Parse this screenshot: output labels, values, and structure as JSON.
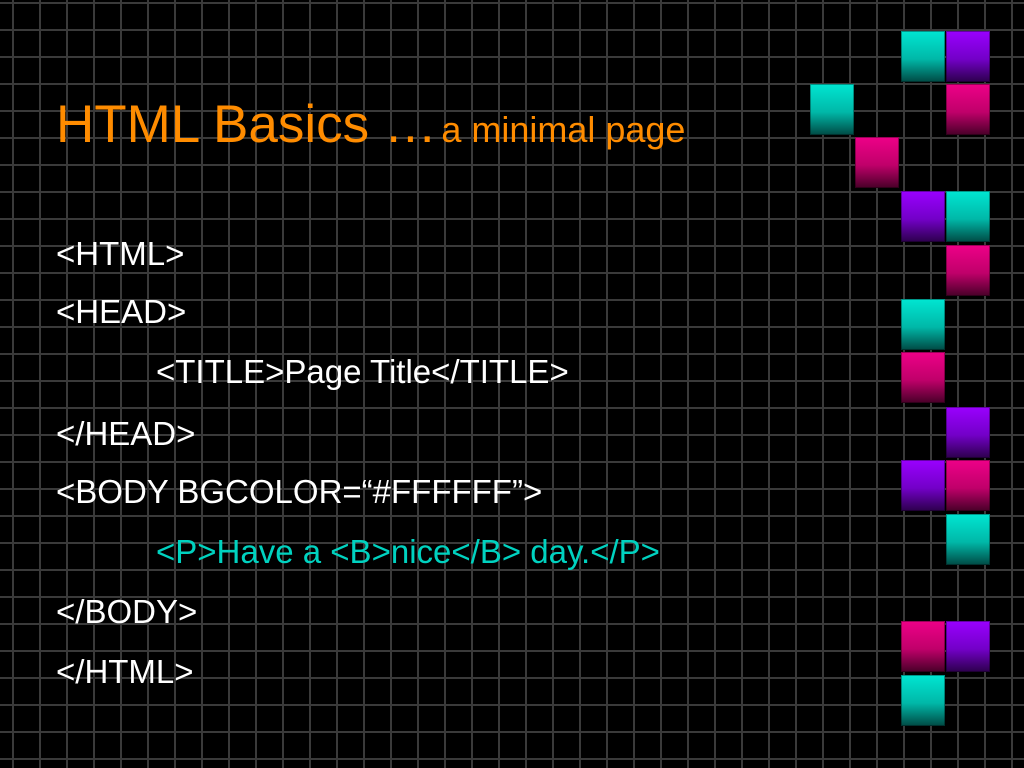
{
  "slide": {
    "title_main": "HTML Basics …",
    "title_sub": "a minimal page",
    "code_lines": [
      "<HTML>",
      "<HEAD>",
      "<TITLE>Page Title</TITLE>",
      "</HEAD>",
      "<BODY BGCOLOR=“#FFFFFF”>",
      "<P>Have a <B>nice</B> day.</P>",
      "</BODY>",
      "</HTML>"
    ]
  },
  "colors": {
    "background": "#000000",
    "grid": "#3a3a3a",
    "title": "#ff8c00",
    "code_text": "#ffffff",
    "highlight_text": "#00d2c0",
    "tile_cyan": "#00d2c0",
    "tile_purple": "#8000e0",
    "tile_magenta": "#d4007a"
  }
}
